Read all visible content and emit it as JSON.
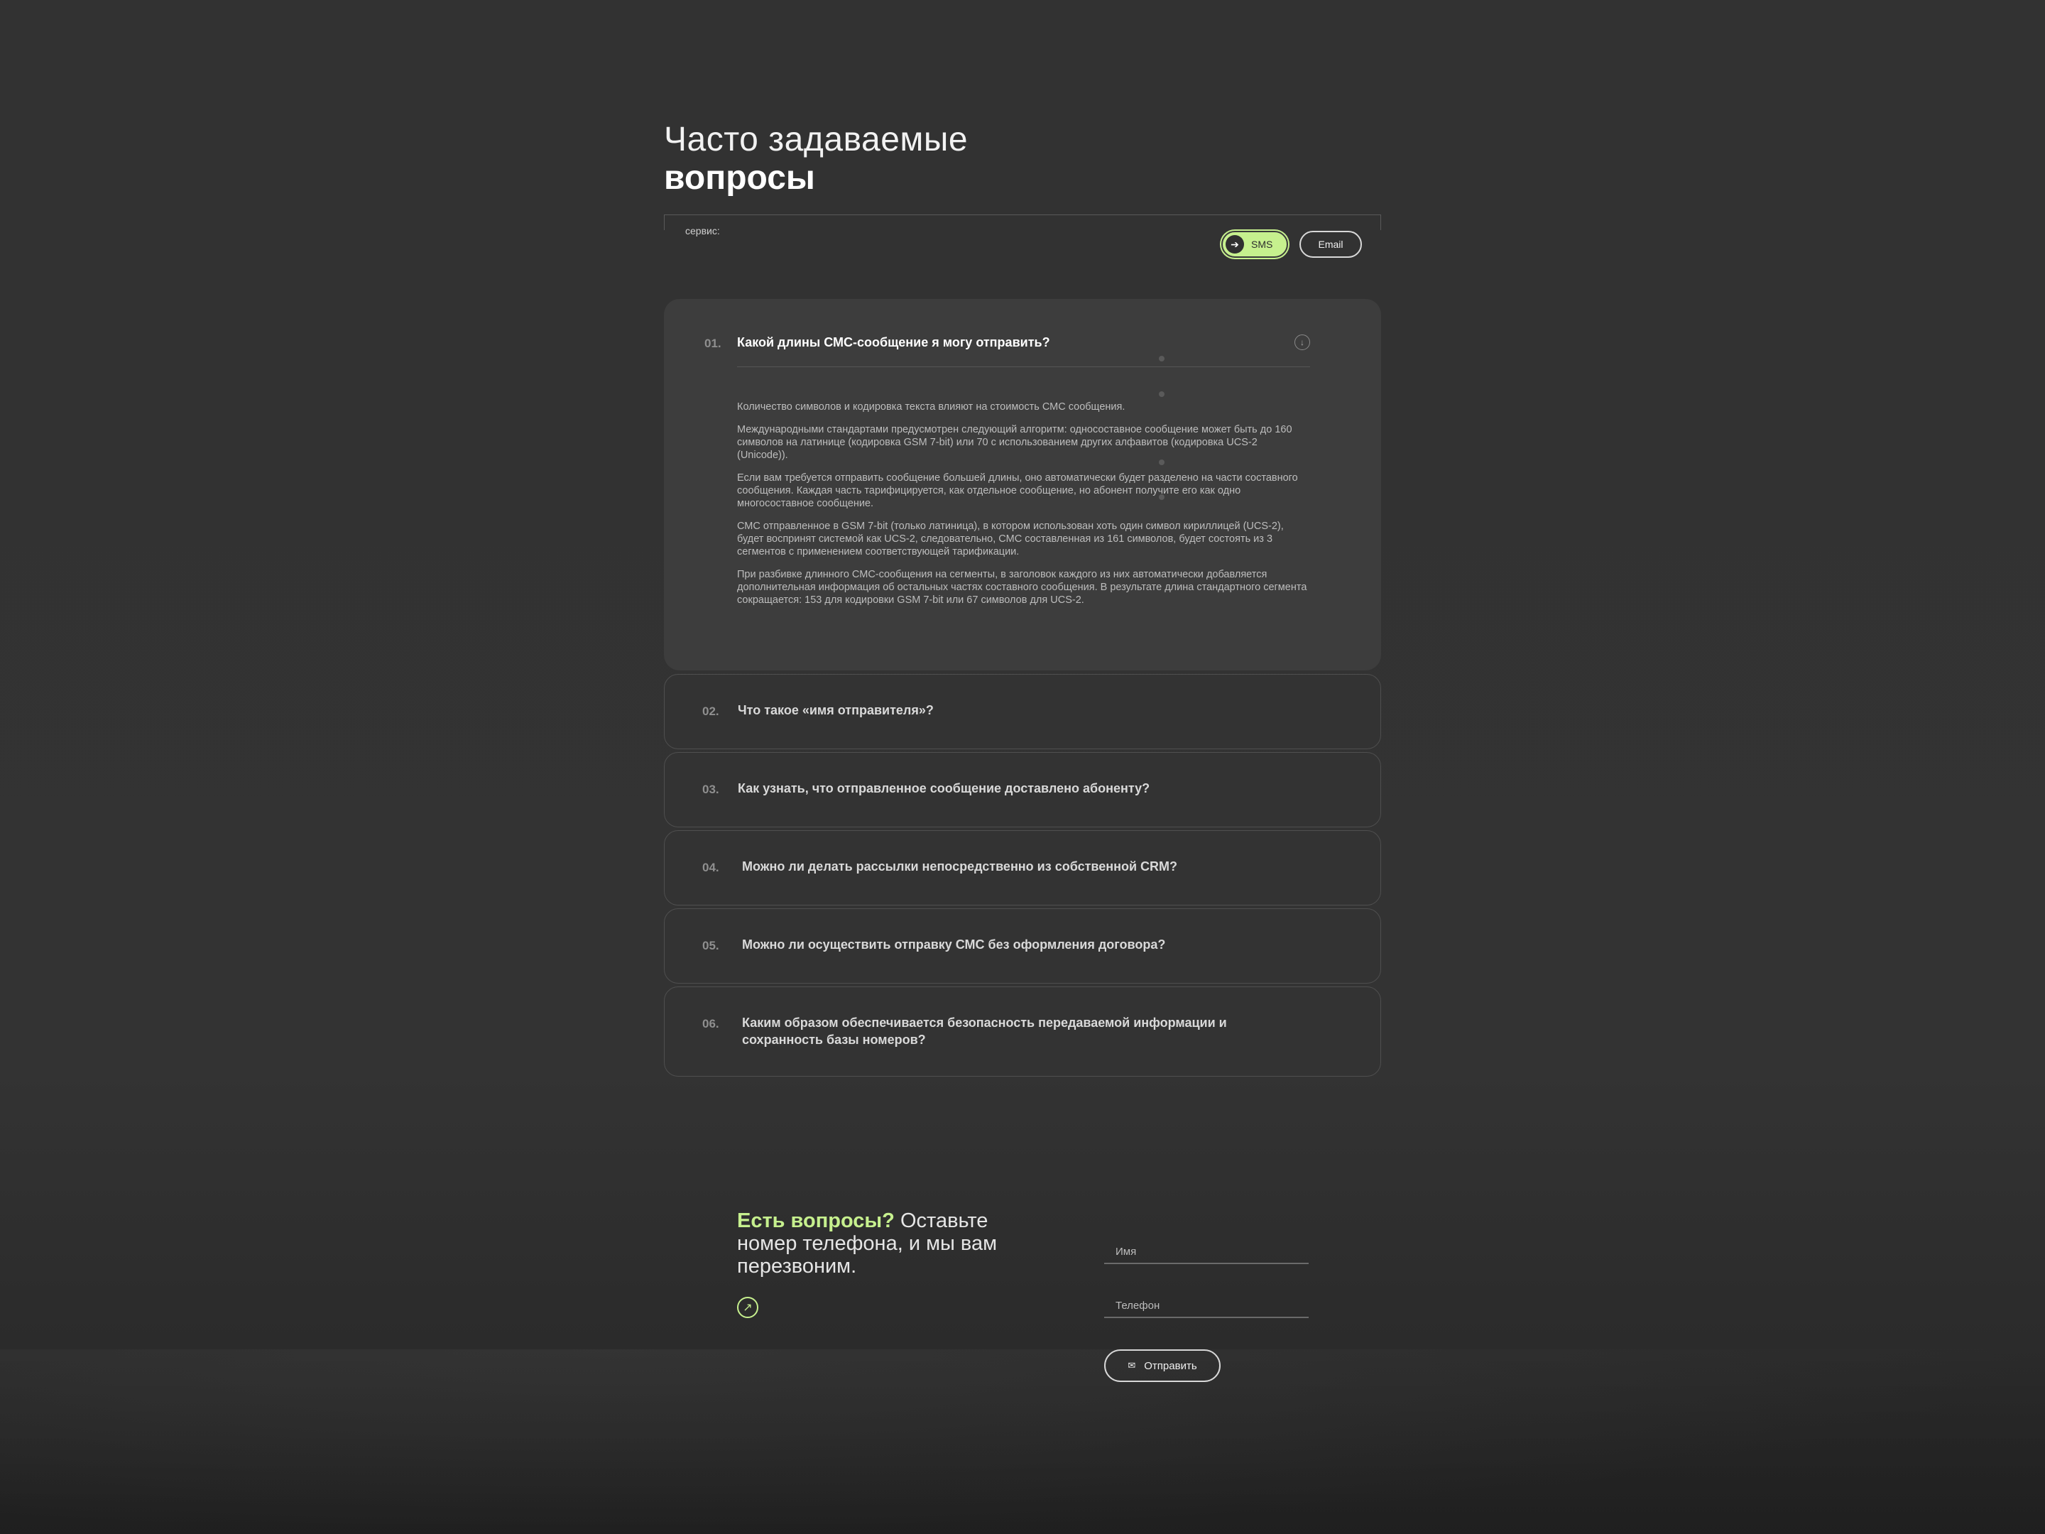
{
  "header": {
    "title_light": "Часто задаваемые",
    "title_bold": "вопросы"
  },
  "service": {
    "label": "сервис:",
    "options": [
      "SMS",
      "Email"
    ],
    "selected": "SMS",
    "accent_color": "#c6f08e"
  },
  "faq": [
    {
      "num": "01.",
      "question": "Какой длины СМС-сообщение я могу отправить?",
      "expanded": true,
      "answer": [
        "Количество символов и кодировка текста влияют на стоимость СМС сообщения.",
        "Международными стандартами предусмотрен следующий алгоритм: односоставное сообщение может быть до 160 символов на латинице (кодировка GSM 7-bit) или 70 с использованием других алфавитов (кодировка UCS-2 (Unicode)).",
        "Если вам требуется отправить сообщение большей длины, оно автоматически будет разделено на части составного сообщения. Каждая часть тарифицируется, как отдельное сообщение, но абонент получите его как одно многосоставное сообщение.",
        "СМС отправленное в GSM 7-bit (только латиница), в котором использован хоть один символ кириллицей (UCS-2), будет воспринят системой как UCS-2, следовательно, СМС составленная из 161 символов, будет состоять из 3 сегментов с применением соответствующей тарификации.",
        "При разбивке длинного СМС-сообщения на сегменты, в заголовок каждого из них автоматически добавляется дополнительная информация об остальных частях составного сообщения. В результате длина стандартного сегмента сокращается: 153 для кодировки GSM 7-bit или 67 символов для UCS-2."
      ]
    },
    {
      "num": "02.",
      "question": "Что такое «имя отправителя»?"
    },
    {
      "num": "03.",
      "question": "Как узнать, что отправленное сообщение доставлено абоненту?"
    },
    {
      "num": "04.",
      "question": "Можно ли делать рассылки непосредственно из собственной CRM?"
    },
    {
      "num": "05.",
      "question": "Можно ли осуществить отправку СМС без оформления договора?"
    },
    {
      "num": "06.",
      "question": "Каким образом обеспечивается безопасность передаваемой информации и сохранность базы номеров?"
    }
  ],
  "contact": {
    "accent": "Есть вопросы?",
    "text": " Оставьте номер телефона, и мы вам перезвоним.",
    "name_placeholder": "Имя",
    "phone_placeholder": "Телефон",
    "submit_label": "Отправить"
  }
}
